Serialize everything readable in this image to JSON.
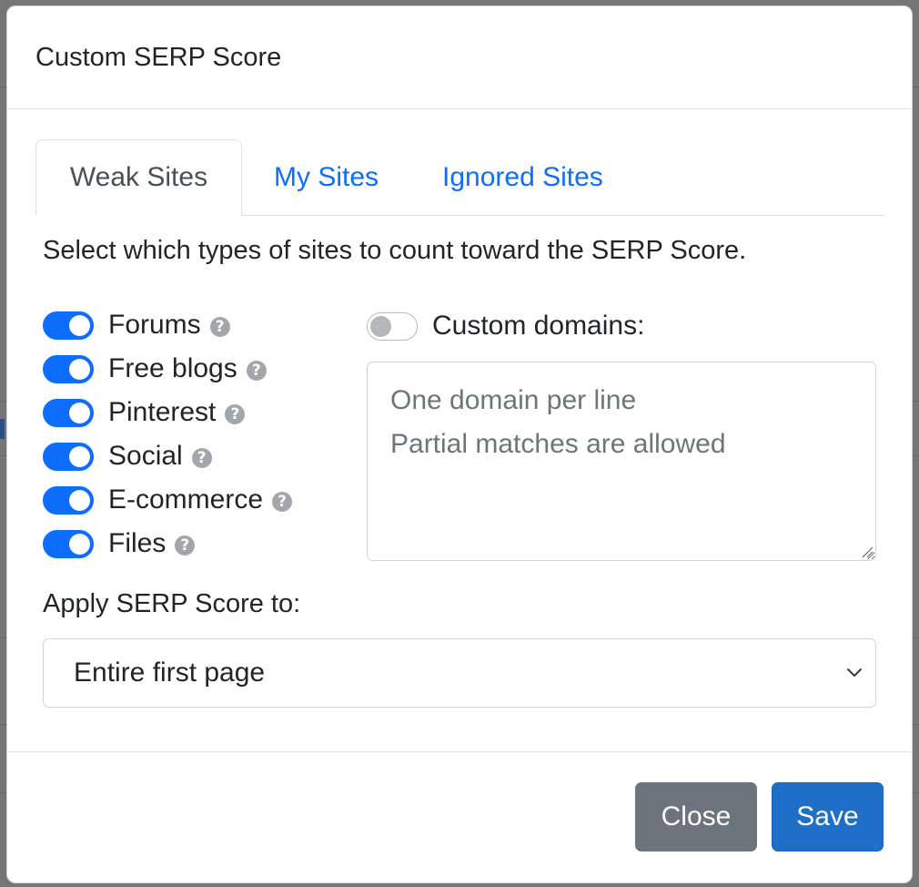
{
  "modal": {
    "title": "Custom SERP Score"
  },
  "tabs": [
    {
      "label": "Weak Sites",
      "active": true
    },
    {
      "label": "My Sites",
      "active": false
    },
    {
      "label": "Ignored Sites",
      "active": false
    }
  ],
  "weak_sites": {
    "instructions": "Select which types of sites to count toward the SERP Score.",
    "switches": [
      {
        "label": "Forums",
        "checked": true,
        "help_icon": "question-circle-icon"
      },
      {
        "label": "Free blogs",
        "checked": true,
        "help_icon": "question-circle-icon"
      },
      {
        "label": "Pinterest",
        "checked": true,
        "help_icon": "question-circle-icon"
      },
      {
        "label": "Social",
        "checked": true,
        "help_icon": "question-circle-icon"
      },
      {
        "label": "E-commerce",
        "checked": true,
        "help_icon": "question-circle-icon"
      },
      {
        "label": "Files",
        "checked": true,
        "help_icon": "question-circle-icon"
      }
    ],
    "custom_domains": {
      "label": "Custom domains:",
      "checked": false,
      "value": "",
      "placeholder": "One domain per line\nPartial matches are allowed"
    },
    "apply_label": "Apply SERP Score to:",
    "apply_select": {
      "selected": "Entire first page"
    }
  },
  "footer": {
    "close_label": "Close",
    "save_label": "Save"
  },
  "colors": {
    "primary": "#0d6efd",
    "save_button": "#1f6fc8",
    "close_button": "#6c757d",
    "help_icon": "#a3a6a9"
  }
}
